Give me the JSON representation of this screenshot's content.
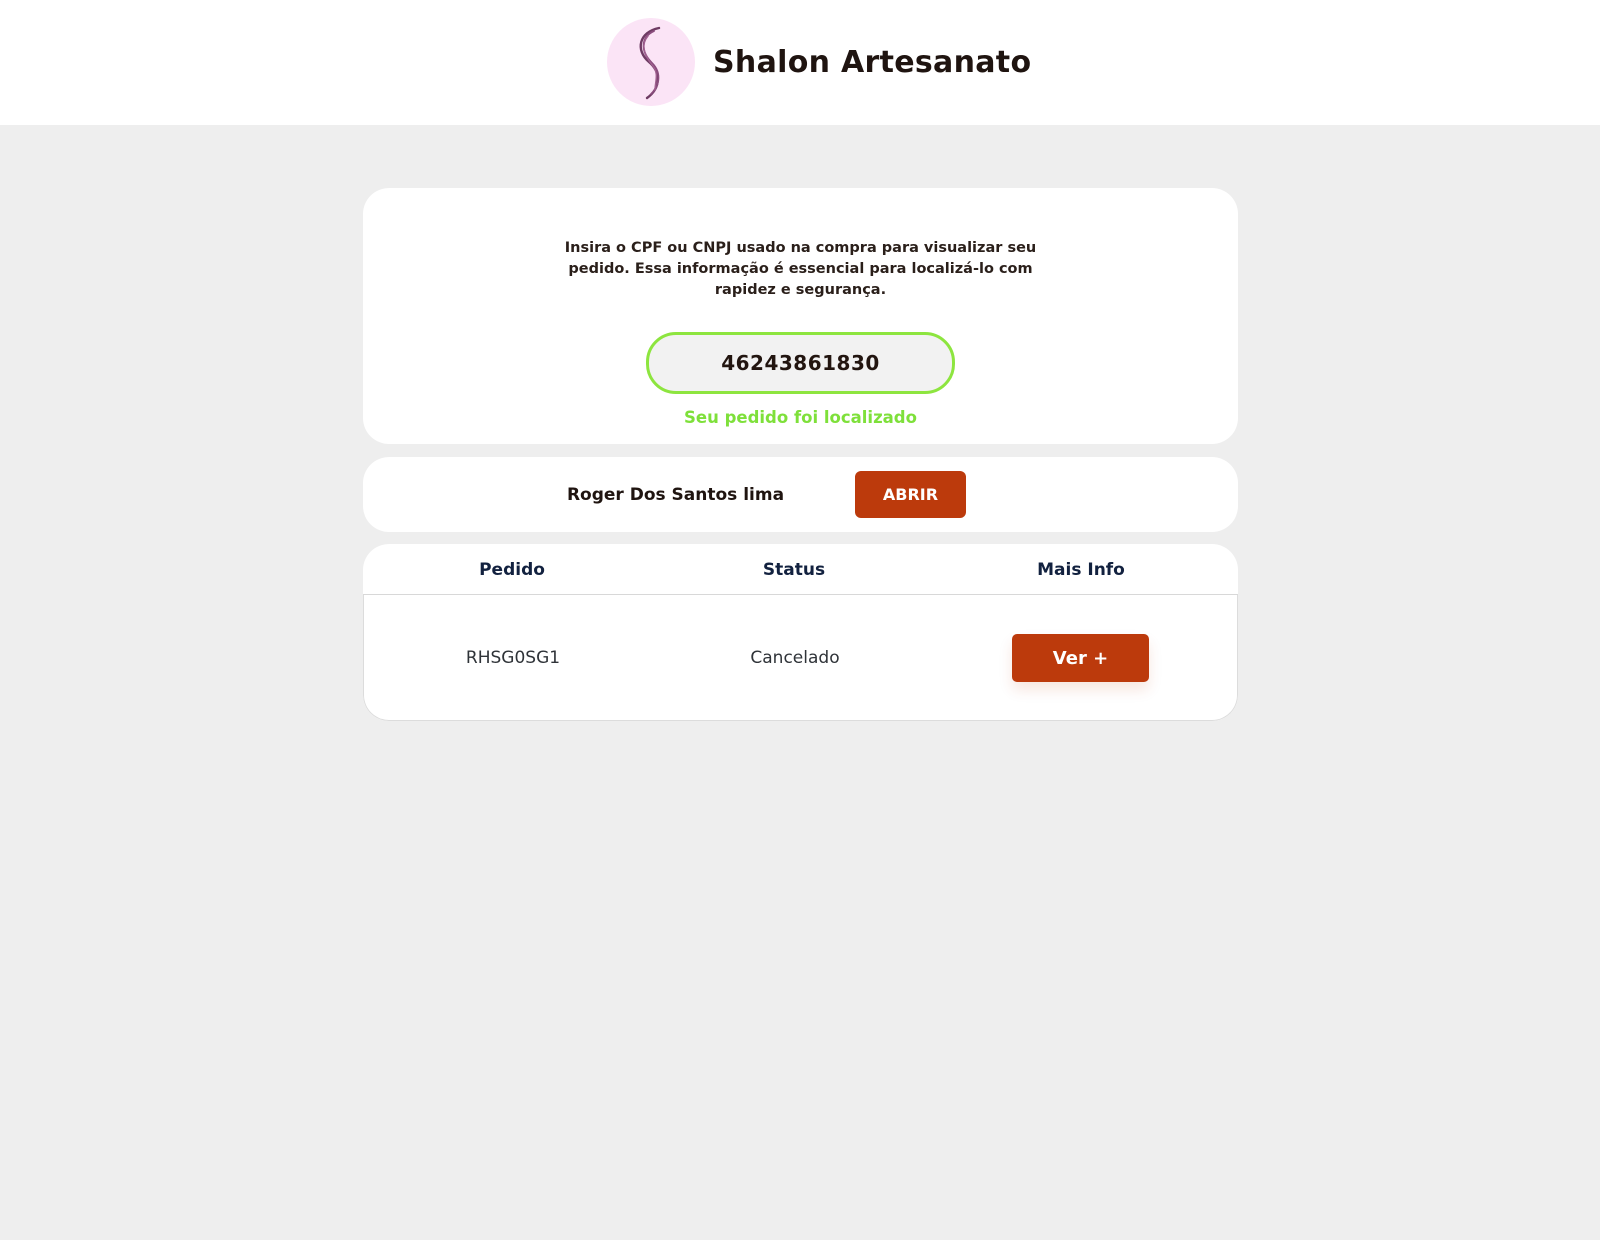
{
  "header": {
    "brand_name": "Shalon Artesanato",
    "logo_icon": "hair-swirl-logo-icon"
  },
  "search": {
    "instructions": "Insira o CPF ou CNPJ usado na compra para visualizar seu pedido. Essa informação é essencial para localizá-lo com rapidez e segurança.",
    "cpf_value": "46243861830",
    "status_message": "Seu pedido foi localizado"
  },
  "customer": {
    "name": "Roger Dos Santos lima",
    "open_label": "ABRIR"
  },
  "orders": {
    "columns": [
      "Pedido",
      "Status",
      "Mais Info"
    ],
    "rows": [
      {
        "order_id": "RHSG0SG1",
        "status": "Cancelado",
        "action_label": "Ver +"
      }
    ]
  },
  "colors": {
    "page_background": "#eeeeee",
    "accent": "#bc3a0c",
    "success": "#7ee03a",
    "logo_background": "#fbe4f6"
  }
}
